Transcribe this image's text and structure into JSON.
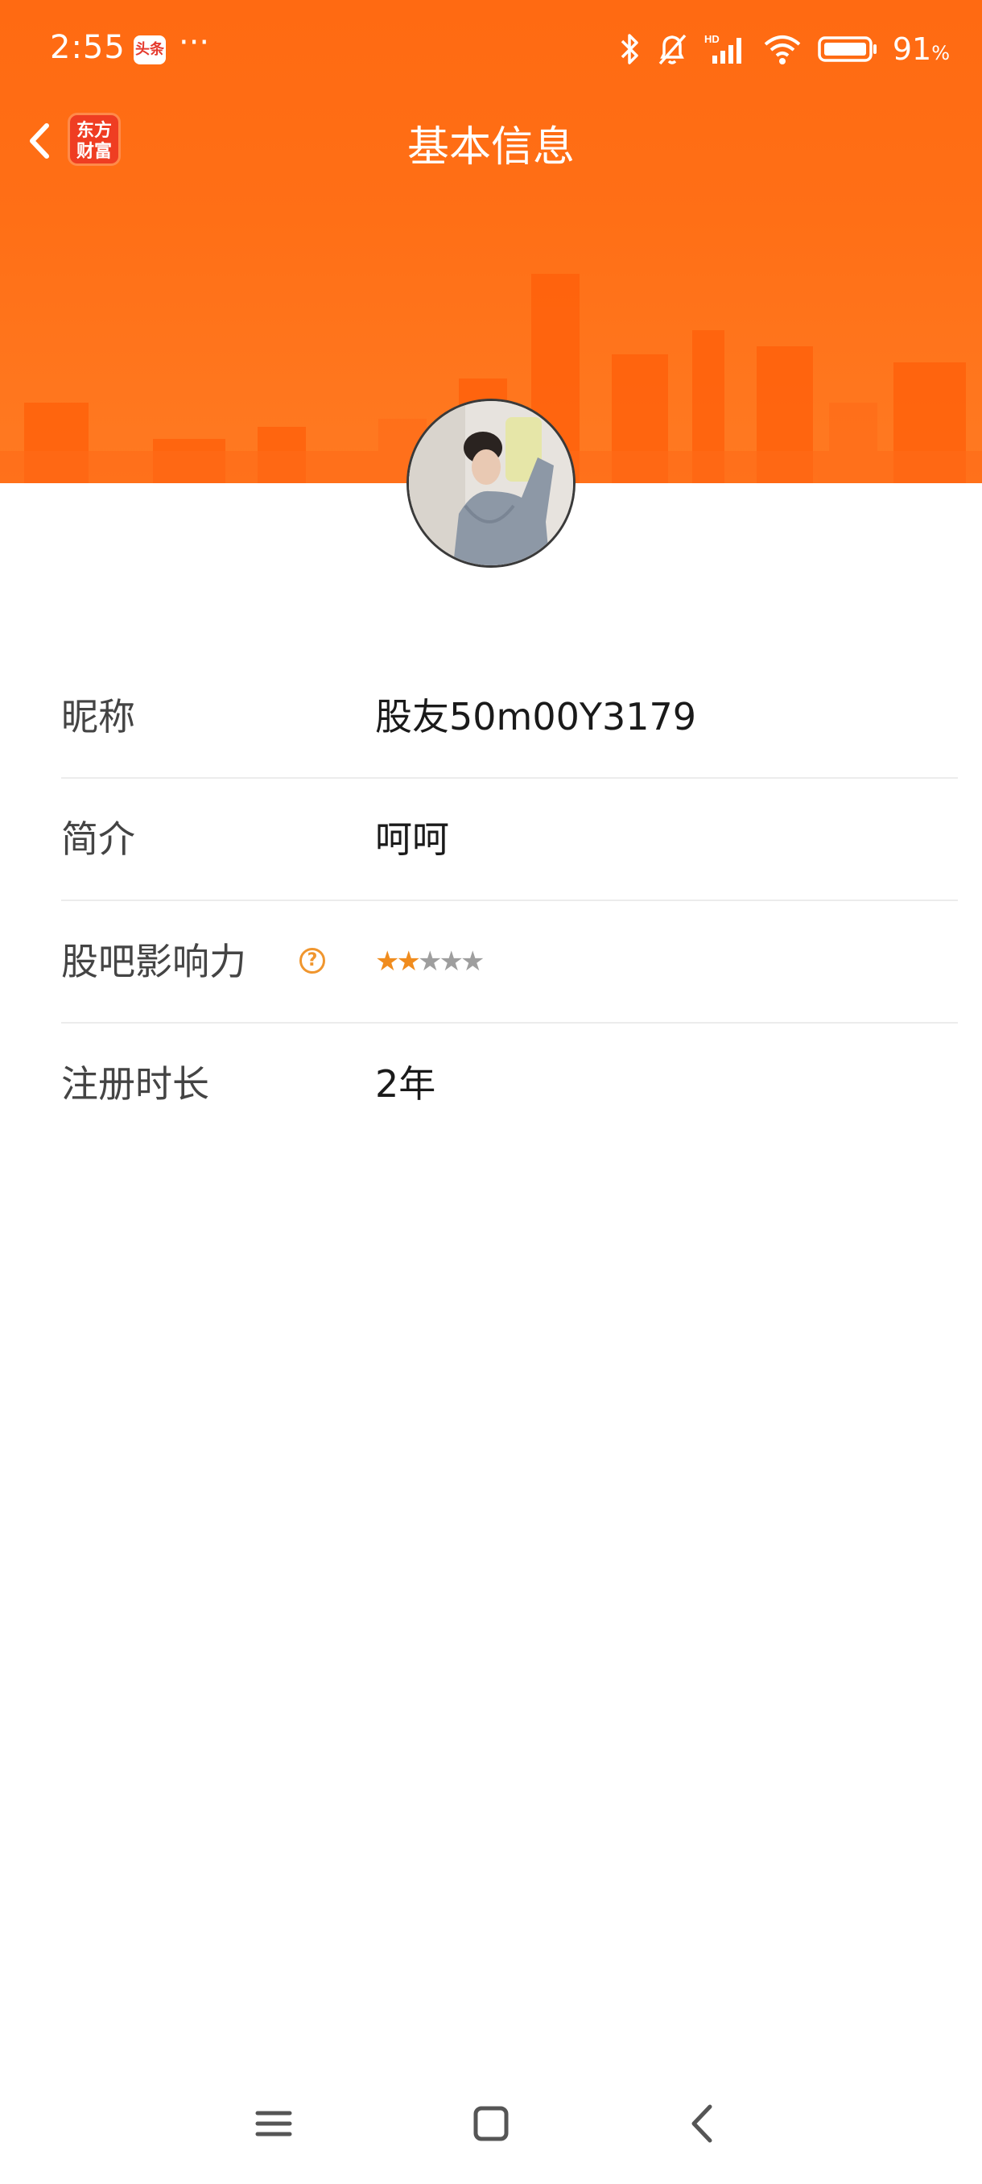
{
  "status_bar": {
    "time": "2:55",
    "notification_badge": "头条",
    "more": "···",
    "battery_percent": "91",
    "battery_unit": "%"
  },
  "nav": {
    "title": "基本信息",
    "logo_line1": "东方",
    "logo_line2": "财富"
  },
  "profile": {
    "rows": [
      {
        "label": "昵称",
        "value": "股友50m00Y3179"
      },
      {
        "label": "简介",
        "value": "呵呵"
      },
      {
        "label": "股吧影响力",
        "help": "?",
        "rating": 2,
        "rating_max": 5
      },
      {
        "label": "注册时长",
        "value": "2年"
      }
    ]
  },
  "colors": {
    "header_orange": "#ff6a12",
    "star_active": "#f08c1e",
    "star_inactive": "#9e9e9e",
    "help_icon": "#f0962e"
  }
}
